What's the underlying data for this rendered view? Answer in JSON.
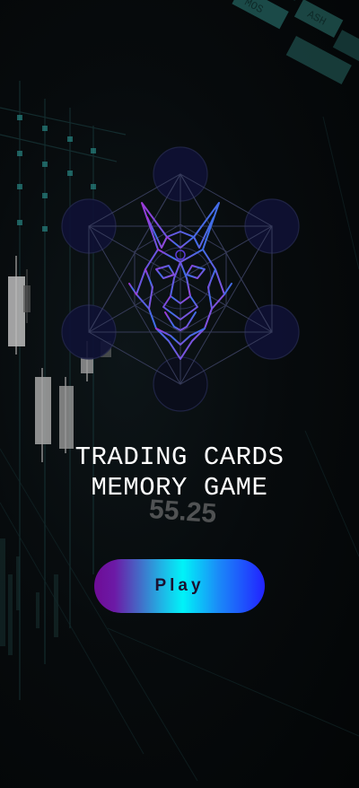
{
  "background": {
    "ticker_value": "55.25",
    "tag_texts": [
      "MOS",
      "ASH"
    ]
  },
  "title": {
    "line1": "TRADING CARDS",
    "line2": "MEMORY GAME"
  },
  "play_button": {
    "label": "Play"
  },
  "colors": {
    "gradient_start": "#6e0c96",
    "gradient_mid": "#00f3f8",
    "gradient_end": "#2222ff",
    "logo_purple": "#a23ad8",
    "logo_blue": "#2f6fe0"
  },
  "icons": {
    "logo": "wolf-metatron-cube-logo"
  }
}
